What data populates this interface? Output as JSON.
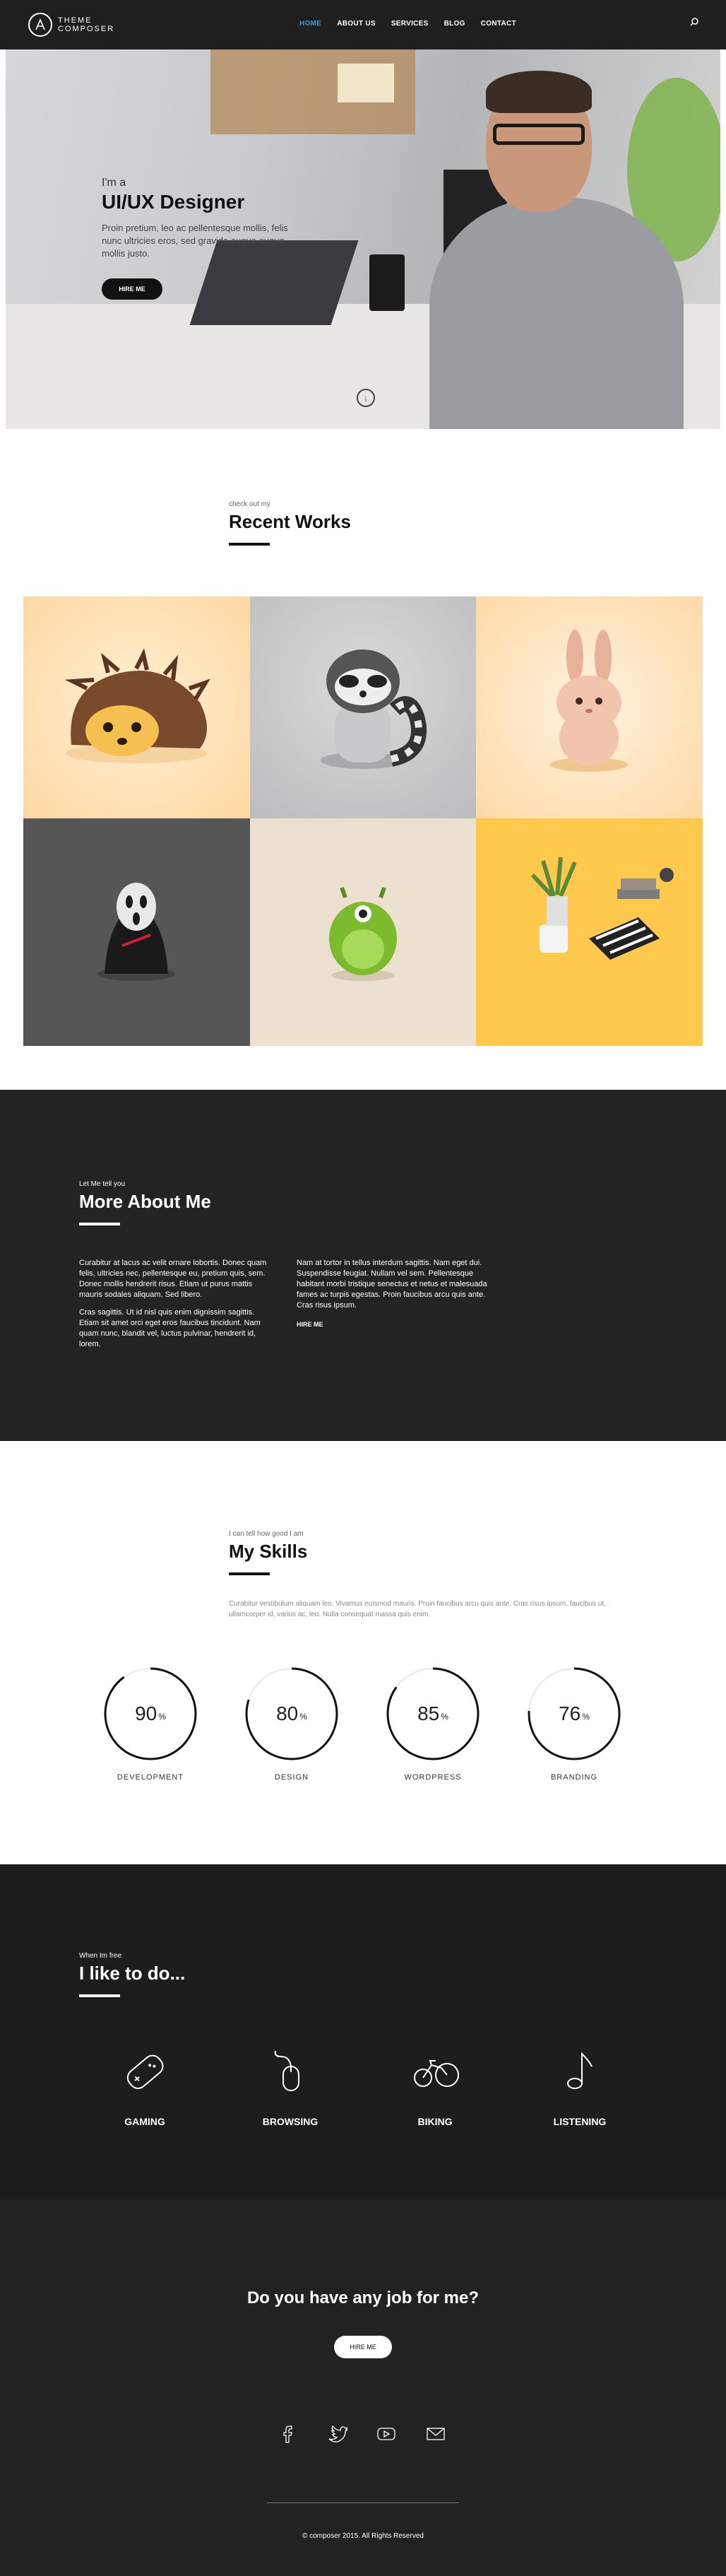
{
  "brand": {
    "line1": "THEME",
    "line2": "COMPOSER"
  },
  "nav": {
    "items": [
      "HOME",
      "ABOUT US",
      "SERVICES",
      "BLOG",
      "CONTACT"
    ],
    "active_index": 0
  },
  "hero": {
    "kicker": "I'm a",
    "title": "UI/UX Designer",
    "description": "Proin pretium, leo ac pellentesque mollis, felis nunc ultricies eros, sed gravida augue augue mollis justo.",
    "button": "HIRE ME"
  },
  "works": {
    "kicker": "check out my",
    "title": "Recent Works"
  },
  "about": {
    "kicker": "Let Me tell you",
    "title": "More About Me",
    "col1_p1": "Curabitur at lacus ac velit ornare lobortis. Donec quam felis, ultricies nec, pellentesque eu, pretium quis, sem. Donec mollis hendrerit risus. Etiam ut purus mattis mauris sodales aliquam. Sed libero.",
    "col1_p2": "Cras sagittis. Ut id nisl quis enim dignissim sagittis. Etiam sit amet orci eget eros faucibus tincidunt. Nam quam nunc, blandit vel, luctus pulvinar, hendrerit id, lorem.",
    "col2_p1": "Nam at tortor in tellus interdum sagittis. Nam eget dui. Suspendisse feugiat. Nullam vel sem. Pellentesque habitant morbi tristique senectus et netus et malesuada fames ac turpis egestas. Proin faucibus arcu quis ante. Cras risus ipsum.",
    "link": "HIRE ME"
  },
  "skills": {
    "kicker": "I can tell how good I am",
    "title": "My Skills",
    "description": "Curabitur vestibulum aliquam leo. Vivamus euismod mauris. Proin faucibus arcu quis ante. Cras risus ipsum, faucibus ut, ullamcorper id, varius ac, leo. Nulla consequat massa quis enim.",
    "items": [
      {
        "value": 90,
        "display": "90",
        "unit": "%",
        "label": "DEVELOPMENT"
      },
      {
        "value": 80,
        "display": "80",
        "unit": "%",
        "label": "DESIGN"
      },
      {
        "value": 85,
        "display": "85",
        "unit": "%",
        "label": "WORDPRESS"
      },
      {
        "value": 76,
        "display": "76",
        "unit": "%",
        "label": "BRANDING"
      }
    ]
  },
  "hobbies": {
    "kicker": "When Im free",
    "title": "I like to do...",
    "items": [
      {
        "icon": "gamepad-icon",
        "label": "GAMING"
      },
      {
        "icon": "mouse-icon",
        "label": "BROWSING"
      },
      {
        "icon": "bicycle-icon",
        "label": "BIKING"
      },
      {
        "icon": "music-note-icon",
        "label": "LISTENING"
      }
    ]
  },
  "footer": {
    "question": "Do you have any job for me?",
    "button": "HIRE ME",
    "socials": [
      "facebook-icon",
      "twitter-icon",
      "youtube-icon",
      "mail-icon"
    ],
    "copyright": "© composer 2015. All Rights Reserved"
  },
  "colors": {
    "accent": "#3b9ad9",
    "dark": "#232323",
    "darker": "#1d1d1d",
    "ring": "#111111"
  }
}
